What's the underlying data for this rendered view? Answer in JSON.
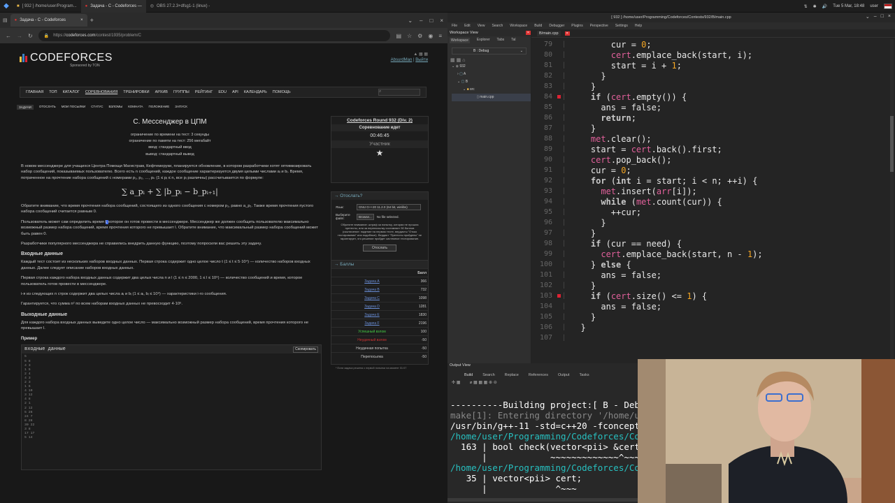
{
  "taskbar": {
    "tasks": [
      "[ 932 ] /home/user/Program...",
      "Задача - C - Codeforces —",
      "OBS 27.2.3+dfsg1-1 (linux) -"
    ],
    "clock": "Tue 5 Mar, 18:48",
    "user": "user"
  },
  "browser": {
    "tabs": [
      "Задача - C - Codeforces"
    ],
    "url_prefix": "https://",
    "url_domain": "codeforces.com",
    "url_path": "/contest/1935/problem/C",
    "page": {
      "logo": "CODEFORCES",
      "sponsor": "Sponsored by TON",
      "user": "AbsurdMan",
      "logout": "Выйти",
      "menu": [
        "ГЛАВНАЯ",
        "ТОП",
        "КАТАЛОГ",
        "СОРЕВНОВАНИЯ",
        "ТРЕНИРОВКИ",
        "АРХИВ",
        "ГРУППЫ",
        "РЕЙТИНГ",
        "EDU",
        "API",
        "КАЛЕНДАРЬ",
        "ПОМОЩЬ"
      ],
      "submenu": [
        "ЗАДАЧИ",
        "ОТОСЛАТЬ",
        "МОИ ПОСЫЛКИ",
        "СТАТУС",
        "ВЗЛОМЫ",
        "КОМНАТА",
        "ПОЛОЖЕНИЕ",
        "ЗАПУСК"
      ],
      "problem": {
        "title": "C. Мессенджер в ЦПМ",
        "time_limit": "ограничение по времени на тест: 3 секунды",
        "mem_limit": "ограничение по памяти на тест: 256 мегабайт",
        "input": "ввод: стандартный ввод",
        "output": "вывод: стандартный вывод",
        "p1": "В новом мессенджере для учащихся Центра Помощи Магистрам, Кефтемеруки, планируется обновление, в котором разработчики хотят оптимизировать набор сообщений, показываемых пользователю. Всего есть n сообщений, каждое сообщение характеризуется двумя целыми числами aᵢ и bᵢ. Время, потраченное на прочтение набора сообщений с номерами p₁, p₂, …, pₖ (1 ≤ pᵢ ≤ n, все pᵢ различны) рассчитывается по формуле:",
        "formula": "∑ a_pᵢ + ∑ |b_pᵢ − b_pᵢ₊₁|",
        "p2": "Обратите внимание, что время прочтения набора сообщений, состоящего из одного сообщения с номером p₁, равно a_p₁. Также время прочтения пустого набора сообщений считается равным 0.",
        "p3a": "Пользователь может сам определить время ",
        "p3hl": "l, ",
        "p3b": "которое он готов провести в мессенджере. Мессенджер же должен сообщить пользователю максимально возможный размер набора сообщений, время прочтения которого не превышает l. Обратите внимание, что максимальный размер набора сообщений может быть равен 0.",
        "p4": "Разработчики популярного мессенджера не справились внедрить данную функцию, поэтому попросили вас решить эту задачу.",
        "in_h": "Входные данные",
        "in1": "Каждый тест состоит из нескольких наборов входных данных. Первая строка содержит одно целое число t (1 ≤ t ≤ 5·10⁴) — количество наборов входных данных. Далее следует описание наборов входных данных.",
        "in2": "Первая строка каждого набора входных данных содержит два целых числа n и l (1 ≤ n ≤ 2000, 1 ≤ l ≤ 10⁹) — количество сообщений и время, которое пользователь готов провести в мессенджере.",
        "in3": "i-я из следующих n строк содержит два целых числа aᵢ и bᵢ (1 ≤ aᵢ, bᵢ ≤ 10⁹) — характеристики i-го сообщения.",
        "in4": "Гарантируется, что сумма n² по всем наборам входных данных не превосходит 4·10⁶.",
        "out_h": "Выходные данные",
        "out1": "Для каждого набора входных данных выведите одно целое число — максимально возможный размер набора сообщений, время прочтения которого не превышает l.",
        "example_h": "Пример",
        "input_label": "входные данные",
        "copy": "Скопировать",
        "example_lines": [
          "5",
          "5 8",
          "4 3",
          "1 5",
          "2 4",
          "4 3",
          "2 3",
          "1 6",
          "4 10",
          "3 12",
          "4 8",
          "2 1",
          "2 12",
          "5 26",
          "24 7",
          "8 28",
          "30 22",
          "3 8",
          "17 17",
          "5 14"
        ]
      },
      "contest": {
        "name": "Codeforces Round 932 (Div. 2)",
        "status": "Соревнование идет",
        "timer": "00:46:45",
        "role": "Участник"
      },
      "submit": {
        "title": "→ Отослать?",
        "lang_label": "Язык:",
        "lang": "GNU G++20 11.2.0 (64 bit, winlibs)",
        "file_label": "Выберите файл:",
        "browse": "Browse...",
        "nofile": "No file selected.",
        "note": "Обратите внимание: штраф за попытку, которая не прошла претесты, или за перепосылку составляет 50 баллов (исключение: падение на первом тесте, вердикты \"Отказ тестирования\" или подобные). Вердикт \"Претесты пройдены\" не гарантирует, что решение пройдет системное тестирование.",
        "button": "Отослать"
      },
      "scores": {
        "title": "→ Баллы",
        "col": "Балл",
        "rows": [
          [
            "Задача A",
            "366"
          ],
          [
            "Задача B",
            "732"
          ],
          [
            "Задача C",
            "1098"
          ],
          [
            "Задача D",
            "1281"
          ],
          [
            "Задача E",
            "1830"
          ],
          [
            "Задача F",
            "2196"
          ],
          [
            "Успешный взлом",
            "100"
          ],
          [
            "Неудачный взлом",
            "-50"
          ],
          [
            "Неудачная попытка",
            "-50"
          ],
          [
            "Перепосылка",
            "-50"
          ]
        ],
        "footnote": "* Если задача решена с первой попытки на момент 01:07"
      }
    }
  },
  "ide": {
    "title": "[ 932 ] /home/user/Programming/Codeforces/Contests/932/B/main.cpp",
    "menu": [
      "File",
      "Edit",
      "View",
      "Search",
      "Workspace",
      "Build",
      "Debugger",
      "Plugins",
      "Perspective",
      "Settings",
      "Help"
    ],
    "workspace": {
      "title": "Workspace View",
      "tabs": [
        "Workspace",
        "Explorer",
        "Tabs",
        "Tal"
      ],
      "config": "B : Debug",
      "tree": [
        "932",
        "A",
        "B",
        "src",
        "main.cpp"
      ]
    },
    "editor_tab": "B/main.cpp",
    "code": [
      [
        "79",
        "        cur = 0;"
      ],
      [
        "80",
        "        cert.emplace_back(start, i);"
      ],
      [
        "81",
        "        start = i + 1;"
      ],
      [
        "82",
        "      }"
      ],
      [
        "83",
        "    }"
      ],
      [
        "84",
        "    if (cert.empty()) {"
      ],
      [
        "85",
        "      ans = false;"
      ],
      [
        "86",
        "      return;"
      ],
      [
        "87",
        "    }"
      ],
      [
        "88",
        "    met.clear();"
      ],
      [
        "89",
        "    start = cert.back().first;"
      ],
      [
        "90",
        "    cert.pop_back();"
      ],
      [
        "91",
        "    cur = 0;"
      ],
      [
        "92",
        "    for (int i = start; i < n; ++i) {"
      ],
      [
        "93",
        "      met.insert(arr[i]);"
      ],
      [
        "94",
        "      while (met.count(cur)) {"
      ],
      [
        "95",
        "        ++cur;"
      ],
      [
        "96",
        "      }"
      ],
      [
        "97",
        "    }"
      ],
      [
        "98",
        "    if (cur == need) {"
      ],
      [
        "99",
        "      cert.emplace_back(start, n - 1);"
      ],
      [
        "100",
        "    } else {"
      ],
      [
        "101",
        "      ans = false;"
      ],
      [
        "102",
        "    }"
      ],
      [
        "103",
        "    if (cert.size() <= 1) {"
      ],
      [
        "104",
        "      ans = false;"
      ],
      [
        "105",
        "    }"
      ],
      [
        "106",
        "  }"
      ],
      [
        "107",
        ""
      ]
    ],
    "output": {
      "title": "Output View",
      "tabs": [
        "Build",
        "Search",
        "Replace",
        "References",
        "Output",
        "Tasks"
      ],
      "lines": [
        "----------Building project:[ B - Deb",
        "make[1]: Entering directory '/home/u",
        "/usr/bin/g++-11 -std=c++20 -fconcept",
        "/home/user/Programming/Codeforces/Co",
        "  163 | bool check(vector<pii> &cert",
        "      |            ~~~~~~~~~~~~~^~~~",
        "/home/user/Programming/Codeforces/Co",
        "   35 | vector<pii> cert;",
        "      |             ^~~~"
      ]
    }
  }
}
